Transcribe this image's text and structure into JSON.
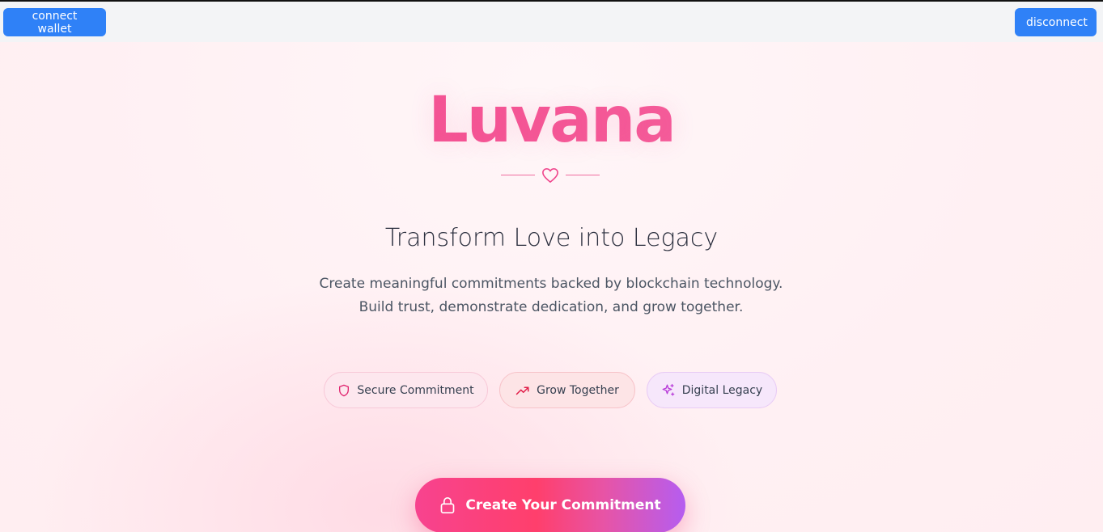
{
  "header": {
    "connect_label": "connect wallet",
    "disconnect_label": "disconnect"
  },
  "hero": {
    "brand": "Luvana",
    "headline": "Transform Love into Legacy",
    "subtext": "Create meaningful commitments backed by blockchain technology. Build trust, demonstrate dedication, and grow together."
  },
  "features": [
    {
      "label": "Secure Commitment",
      "icon": "shield-icon"
    },
    {
      "label": "Grow Together",
      "icon": "trending-up-icon"
    },
    {
      "label": "Digital Legacy",
      "icon": "sparkles-icon"
    }
  ],
  "cta": {
    "label": "Create Your Commitment",
    "icon": "lock-icon"
  },
  "colors": {
    "button_blue": "#2f81f7",
    "brand_pink": "#f3468a",
    "accent_purple": "#b55df0"
  }
}
